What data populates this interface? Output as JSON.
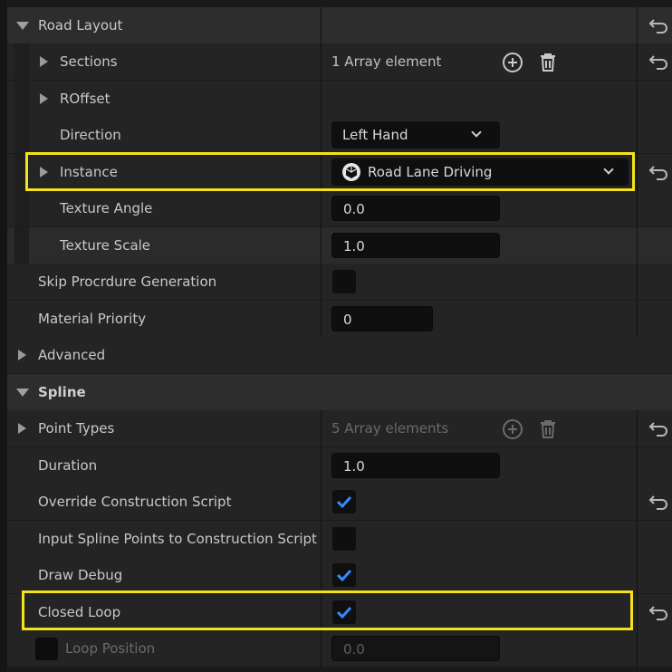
{
  "rows": {
    "road_layout": {
      "label": "Road Layout"
    },
    "sections": {
      "label": "Sections",
      "value": "1 Array element"
    },
    "roffset": {
      "label": "ROffset"
    },
    "direction": {
      "label": "Direction",
      "value": "Left Hand"
    },
    "instance": {
      "label": "Instance",
      "value": "Road Lane Driving"
    },
    "texture_angle": {
      "label": "Texture Angle",
      "value": "0.0"
    },
    "texture_scale": {
      "label": "Texture Scale",
      "value": "1.0"
    },
    "skip_proc": {
      "label": "Skip Procrdure Generation",
      "checked": false
    },
    "material_priority": {
      "label": "Material Priority",
      "value": "0"
    },
    "advanced": {
      "label": "Advanced"
    },
    "spline": {
      "label": "Spline"
    },
    "point_types": {
      "label": "Point Types",
      "value": "5 Array elements"
    },
    "duration": {
      "label": "Duration",
      "value": "1.0"
    },
    "override_construction": {
      "label": "Override Construction Script",
      "checked": true
    },
    "input_spline_points": {
      "label": "Input Spline Points to Construction Script",
      "checked": false
    },
    "draw_debug": {
      "label": "Draw Debug",
      "checked": true
    },
    "closed_loop": {
      "label": "Closed Loop",
      "checked": true
    },
    "loop_position": {
      "label": "Loop Position",
      "value": "0.0"
    }
  },
  "colors": {
    "highlight_frame": "#f4e31a",
    "checkmark": "#2f8cff",
    "panel_bg": "#242424"
  },
  "icons": {
    "reset": "reset-arrow-icon",
    "add": "plus-circle-icon",
    "delete": "trash-icon",
    "asset": "unreal-asset-icon"
  }
}
